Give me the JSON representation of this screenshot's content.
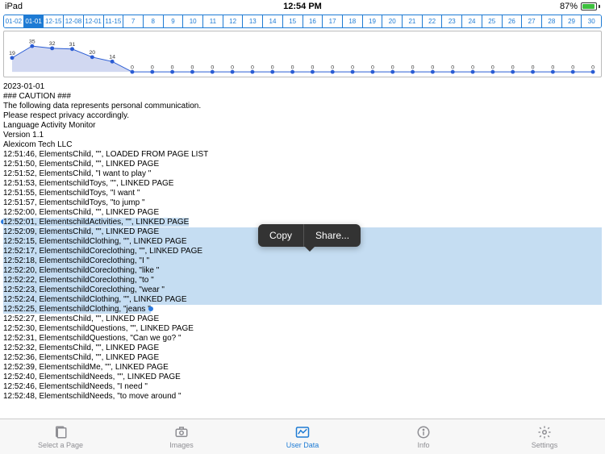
{
  "status": {
    "device": "iPad",
    "time": "12:54 PM",
    "battery_pct": "87%"
  },
  "date_tabs": [
    "01-02",
    "01-01",
    "12-15",
    "12-08",
    "12-01",
    "11-15",
    "7",
    "8",
    "9",
    "10",
    "11",
    "12",
    "13",
    "14",
    "15",
    "16",
    "17",
    "18",
    "19",
    "20",
    "21",
    "22",
    "23",
    "24",
    "25",
    "26",
    "27",
    "28",
    "29",
    "30"
  ],
  "date_tabs_active_index": 1,
  "chart_data": {
    "type": "bar",
    "categories": [
      "01-02",
      "01-01",
      "12-15",
      "12-08",
      "12-01",
      "11-15",
      "7",
      "8",
      "9",
      "10",
      "11",
      "12",
      "13",
      "14",
      "15",
      "16",
      "17",
      "18",
      "19",
      "20",
      "21",
      "22",
      "23",
      "24",
      "25",
      "26",
      "27",
      "28",
      "29",
      "30"
    ],
    "values": [
      19,
      35,
      32,
      31,
      20,
      14,
      0,
      0,
      0,
      0,
      0,
      0,
      0,
      0,
      0,
      0,
      0,
      0,
      0,
      0,
      0,
      0,
      0,
      0,
      0,
      0,
      0,
      0,
      0,
      0
    ],
    "ylim": [
      0,
      40
    ]
  },
  "header_lines": [
    "2023-01-01",
    "### CAUTION ###",
    "The following data represents personal communication.",
    "Please respect privacy accordingly.",
    "",
    "Language Activity Monitor",
    "Version 1.1",
    "Alexicom Tech LLC",
    ""
  ],
  "log_pre": [
    "12:51:46, ElementsChild, \"\", LOADED FROM PAGE LIST",
    "12:51:50, ElementsChild, \"\", LINKED PAGE",
    "12:51:52, ElementsChild, \"I want to play \"",
    "12:51:53, ElementschildToys, \"\", LINKED PAGE",
    "12:51:55, ElementschildToys, \"I want \"",
    "12:51:57, ElementschildToys, \"to jump \"",
    "12:52:00, ElementsChild, \"\", LINKED PAGE"
  ],
  "log_sel_first": "12:52:01, ElementschildActivities, \"\", LINKED PAGE",
  "log_sel": [
    "12:52:09, ElementsChild, \"\", LINKED PAGE",
    "12:52:15, ElementschildClothing, \"\", LINKED PAGE",
    "12:52:17, ElementschildCoreclothing, \"\", LINKED PAGE",
    "12:52:18, ElementschildCoreclothing, \"I \"",
    "12:52:20, ElementschildCoreclothing, \"like \"",
    "12:52:22, ElementschildCoreclothing, \"to \"",
    "12:52:23, ElementschildCoreclothing, \"wear \"",
    "12:52:24, ElementschildClothing, \"\", LINKED PAGE"
  ],
  "log_sel_last": "12:52:25, ElementschildClothing, \"jeans \"",
  "log_post": [
    "12:52:27, ElementsChild, \"\", LINKED PAGE",
    "12:52:30, ElementschildQuestions, \"\", LINKED PAGE",
    "12:52:31, ElementschildQuestions, \"Can we go? \"",
    "12:52:32, ElementsChild, \"\", LINKED PAGE",
    "12:52:36, ElementsChild, \"\", LINKED PAGE",
    "12:52:39, ElementschildMe, \"\", LINKED PAGE",
    "12:52:40, ElementschildNeeds, \"\", LINKED PAGE",
    "12:52:46, ElementschildNeeds, \"I need \"",
    "12:52:48, ElementschildNeeds, \"to move around \""
  ],
  "popover": {
    "copy": "Copy",
    "share": "Share..."
  },
  "tabs": {
    "select": "Select a Page",
    "images": "Images",
    "userdata": "User Data",
    "info": "Info",
    "settings": "Settings"
  }
}
